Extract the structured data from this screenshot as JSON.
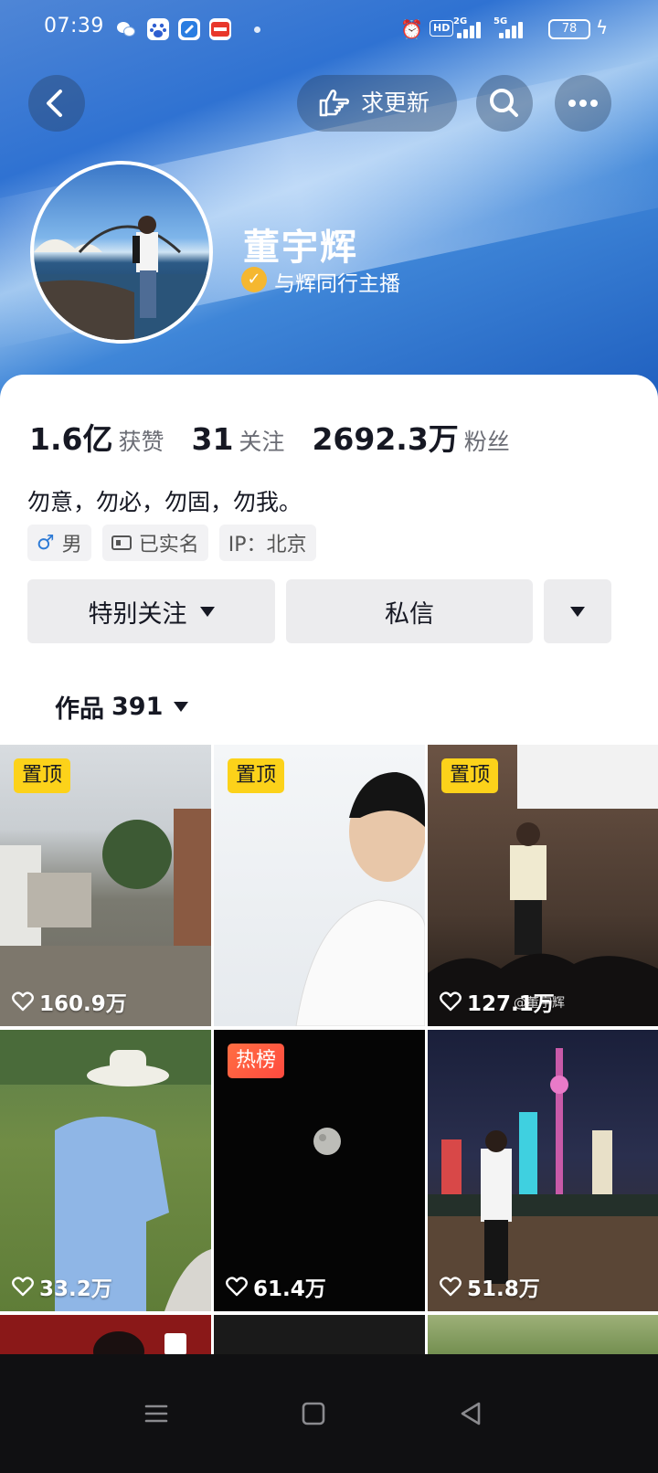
{
  "status_bar": {
    "time": "07:39",
    "network_hd": "HD",
    "sig1": "2G",
    "sig2": "5G",
    "battery": "78"
  },
  "header": {
    "back_icon": "chevron-left-icon",
    "request_update_label": "求更新",
    "search_icon": "search-icon",
    "more_icon": "more-dots-icon"
  },
  "profile": {
    "name": "董宇辉",
    "verified_label": "与辉同行主播",
    "stats": [
      {
        "value": "1.6亿",
        "label": "获赞"
      },
      {
        "value": "31",
        "label": "关注"
      },
      {
        "value": "2692.3万",
        "label": "粉丝"
      }
    ],
    "bio": "勿意，勿必，勿固，勿我。",
    "tags": {
      "gender_symbol": "♂",
      "gender": "男",
      "realname": "已实名",
      "ip": "IP：北京"
    }
  },
  "actions": {
    "follow_label": "特别关注",
    "message_label": "私信"
  },
  "works": {
    "label": "作品",
    "count": "391"
  },
  "videos": [
    {
      "badge": "置顶",
      "badge_type": "pin",
      "likes": "160.9万"
    },
    {
      "badge": "置顶",
      "badge_type": "pin",
      "likes": ""
    },
    {
      "badge": "置顶",
      "badge_type": "pin",
      "likes": "127.1万",
      "overlay": "@董宇辉"
    },
    {
      "badge": "",
      "badge_type": "",
      "likes": "33.2万"
    },
    {
      "badge": "热榜",
      "badge_type": "hot",
      "likes": "61.4万"
    },
    {
      "badge": "",
      "badge_type": "",
      "likes": "51.8万"
    }
  ],
  "colors": {
    "pin_badge": "#fcd21a",
    "hot_badge": "#ff5a40",
    "verified": "#f5b730",
    "gender_male": "#2e7bd6"
  }
}
